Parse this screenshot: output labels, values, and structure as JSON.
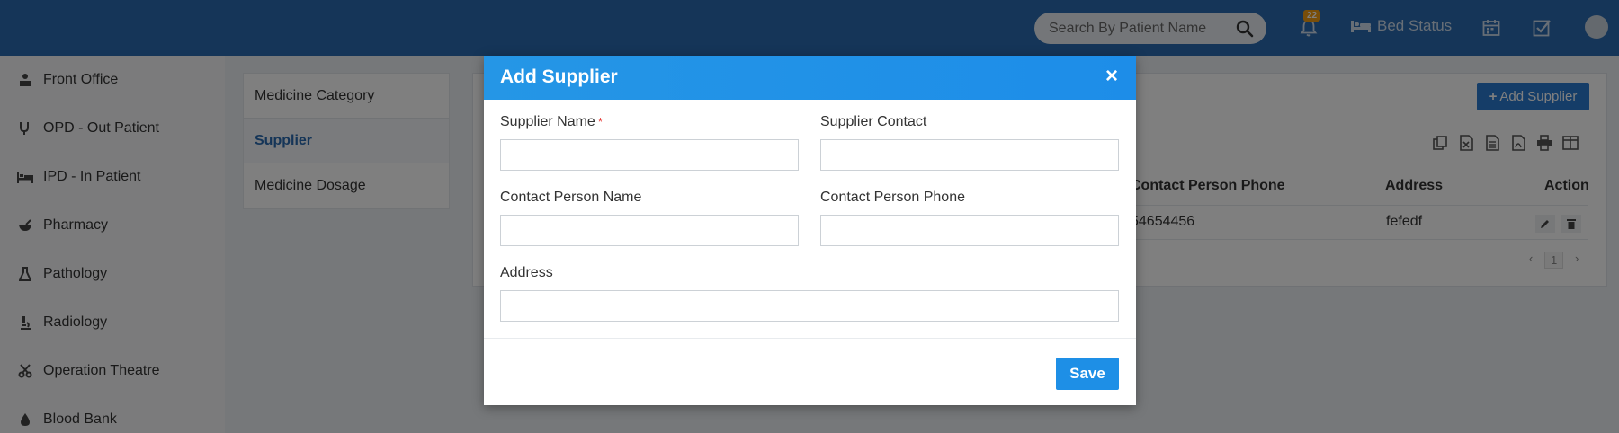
{
  "header": {
    "search_placeholder": "Search By Patient Name",
    "notification_count": "22",
    "bed_status_label": "Bed Status"
  },
  "sidebar": {
    "items": [
      {
        "label": "Front Office",
        "icon": "front-office-icon"
      },
      {
        "label": "OPD - Out Patient",
        "icon": "stethoscope-icon"
      },
      {
        "label": "IPD - In Patient",
        "icon": "bed-icon"
      },
      {
        "label": "Pharmacy",
        "icon": "mortar-pestle-icon"
      },
      {
        "label": "Pathology",
        "icon": "flask-icon"
      },
      {
        "label": "Radiology",
        "icon": "microscope-icon"
      },
      {
        "label": "Operation Theatre",
        "icon": "scissors-icon"
      },
      {
        "label": "Blood Bank",
        "icon": "blood-drop-icon"
      }
    ]
  },
  "submenu": {
    "items": [
      {
        "label": "Medicine Category"
      },
      {
        "label": "Supplier"
      },
      {
        "label": "Medicine Dosage"
      }
    ]
  },
  "content": {
    "add_button": "Add Supplier",
    "columns": [
      "Contact Person Phone",
      "Address",
      "Action"
    ],
    "rows": [
      {
        "contact_person_phone": "54654456",
        "address": "fefedf"
      }
    ],
    "page": "1"
  },
  "modal": {
    "title": "Add Supplier",
    "close": "×",
    "fields": {
      "supplier_name": {
        "label": "Supplier Name",
        "required": "*",
        "value": ""
      },
      "supplier_contact": {
        "label": "Supplier Contact",
        "value": ""
      },
      "contact_person_name": {
        "label": "Contact Person Name",
        "value": ""
      },
      "contact_person_phone": {
        "label": "Contact Person Phone",
        "value": ""
      },
      "address": {
        "label": "Address",
        "value": ""
      }
    },
    "save_label": "Save"
  },
  "colors": {
    "header_bg": "#2a6bb0",
    "modal_header": "#2596e6",
    "primary_button": "#1e8fe6",
    "required": "#e53935"
  }
}
